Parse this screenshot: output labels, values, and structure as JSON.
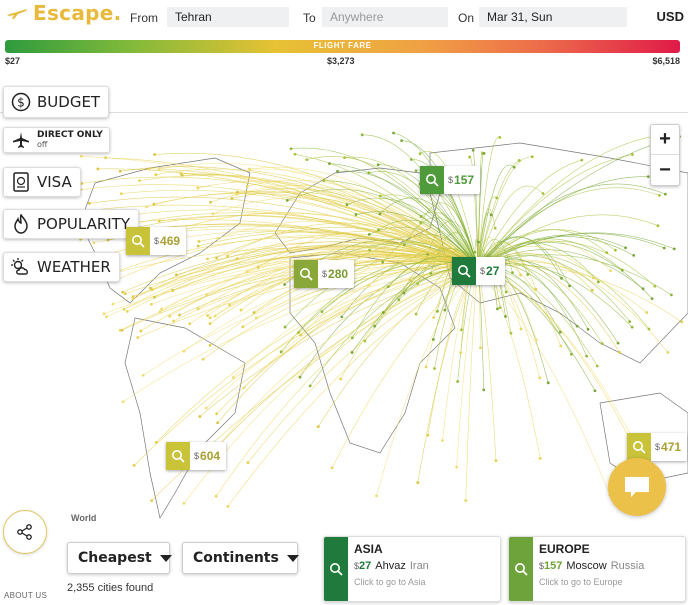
{
  "header": {
    "logo_text": "Escape.",
    "from_label": "From",
    "from_value": "Tehran",
    "to_label": "To",
    "to_placeholder": "Anywhere",
    "on_label": "On",
    "on_value": "Mar 31, Sun",
    "currency": "USD"
  },
  "fare_bar": {
    "title": "FLIGHT FARE",
    "min": "$27",
    "mid": "$3,273",
    "max": "$6,518"
  },
  "filters": {
    "budget": "BUDGET",
    "direct_only": "DIRECT ONLY",
    "direct_state": "off",
    "visa": "VISA",
    "popularity": "POPULARITY",
    "weather": "WEATHER"
  },
  "zoom": {
    "in": "+",
    "out": "−"
  },
  "markers": [
    {
      "currency": "$",
      "price": "157",
      "color": "#4f9a3a"
    },
    {
      "currency": "$",
      "price": "469",
      "color": "#c9c33a"
    },
    {
      "currency": "$",
      "price": "280",
      "color": "#8aa83a"
    },
    {
      "currency": "$",
      "price": "27",
      "color": "#1f7a3b"
    },
    {
      "currency": "$",
      "price": "604",
      "color": "#c9c33a"
    },
    {
      "currency": "$",
      "price": "471",
      "color": "#c9c33a"
    }
  ],
  "map": {
    "world_label": "World"
  },
  "controls": {
    "sort_label": "Cheapest",
    "group_label": "Continents",
    "cities_found": "2,355 cities found",
    "about": "ABOUT US"
  },
  "cards": [
    {
      "region": "ASIA",
      "currency": "$",
      "price": "27",
      "city": "Ahvaz",
      "country": "Iran",
      "hint": "Click to go to Asia",
      "color": "#1f7a3b"
    },
    {
      "region": "EUROPE",
      "currency": "$",
      "price": "157",
      "city": "Moscow",
      "country": "Russia",
      "hint": "Click to go to Europe",
      "color": "#6ea23a"
    }
  ]
}
